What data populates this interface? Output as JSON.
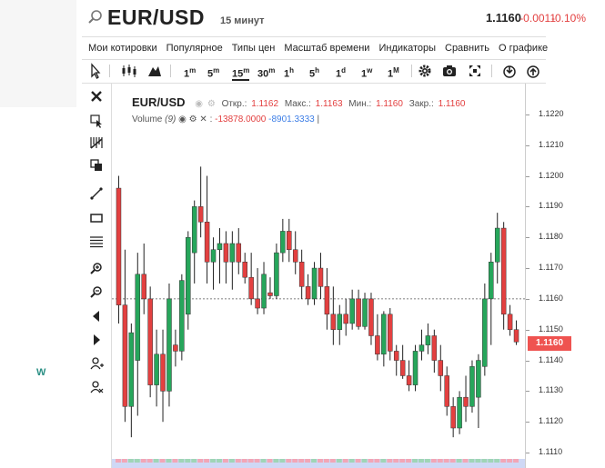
{
  "header": {
    "symbol": "EUR/USD",
    "interval": "15 минут",
    "price": "1.1160",
    "change": "-0.0011",
    "change_pct": "-0.10%"
  },
  "menu": [
    "Мои котировки",
    "Популярное",
    "Типы цен",
    "Масштаб времени",
    "Индикаторы",
    "Сравнить",
    "О графике"
  ],
  "toolbar": {
    "timeframes": [
      {
        "base": "1",
        "sup": "m",
        "active": false
      },
      {
        "base": "5",
        "sup": "m",
        "active": false
      },
      {
        "base": "15",
        "sup": "m",
        "active": true
      },
      {
        "base": "30",
        "sup": "m",
        "active": false
      },
      {
        "base": "1",
        "sup": "h",
        "active": false
      },
      {
        "base": "5",
        "sup": "h",
        "active": false
      },
      {
        "base": "1",
        "sup": "d",
        "active": false
      },
      {
        "base": "1",
        "sup": "w",
        "active": false
      },
      {
        "base": "1",
        "sup": "M",
        "active": false
      }
    ],
    "icons": [
      "cursor-icon",
      "candles-icon",
      "area-chart-icon",
      "settings-icon",
      "camera-icon",
      "fullscreen-icon",
      "download-icon",
      "upload-icon"
    ]
  },
  "side_tools": [
    "close-icon",
    "select-tool-icon",
    "measure-icon",
    "clone-icon",
    "trend-line-icon",
    "rectangle-icon",
    "fib-lines-icon",
    "zoom-in-icon",
    "zoom-out-icon",
    "scroll-left-icon",
    "scroll-right-icon",
    "magnet-add-icon",
    "magnet-remove-icon"
  ],
  "legend": {
    "symbol": "EUR/USD",
    "open_label": "Откр.:",
    "open": "1.1162",
    "high_label": "Макс.:",
    "high": "1.1163",
    "low_label": "Мин.:",
    "low": "1.1160",
    "close_label": "Закр.:",
    "close": "1.1160",
    "volume_label": "Volume",
    "volume_period": "(9)",
    "volume_a": "-13878.0000",
    "volume_b": "-8901.3333"
  },
  "axis": {
    "ticks": [
      "1.1220",
      "1.1210",
      "1.1200",
      "1.1190",
      "1.1180",
      "1.1170",
      "1.1160",
      "1.1150",
      "1.1140",
      "1.1130",
      "1.1120",
      "1.1110"
    ],
    "current": "1.1160"
  },
  "colors": {
    "up": "#26a65b",
    "down": "#e34040",
    "price_tag": "#ef5350"
  },
  "chart_data": {
    "type": "candlestick",
    "ylim": [
      1.1105,
      1.123
    ],
    "candles": [
      {
        "o": 1.1196,
        "h": 1.12,
        "l": 1.1152,
        "c": 1.1158
      },
      {
        "o": 1.1158,
        "h": 1.1176,
        "l": 1.112,
        "c": 1.1125
      },
      {
        "o": 1.1125,
        "h": 1.1152,
        "l": 1.1115,
        "c": 1.1149
      },
      {
        "o": 1.114,
        "h": 1.1175,
        "l": 1.1122,
        "c": 1.1168
      },
      {
        "o": 1.1168,
        "h": 1.1178,
        "l": 1.1155,
        "c": 1.116
      },
      {
        "o": 1.116,
        "h": 1.1164,
        "l": 1.1128,
        "c": 1.1132
      },
      {
        "o": 1.1132,
        "h": 1.115,
        "l": 1.1125,
        "c": 1.1142
      },
      {
        "o": 1.1142,
        "h": 1.115,
        "l": 1.112,
        "c": 1.113
      },
      {
        "o": 1.113,
        "h": 1.1165,
        "l": 1.1125,
        "c": 1.116
      },
      {
        "o": 1.1145,
        "h": 1.115,
        "l": 1.1138,
        "c": 1.1143
      },
      {
        "o": 1.1143,
        "h": 1.1168,
        "l": 1.114,
        "c": 1.1166
      },
      {
        "o": 1.1155,
        "h": 1.1182,
        "l": 1.115,
        "c": 1.118
      },
      {
        "o": 1.1175,
        "h": 1.1192,
        "l": 1.1165,
        "c": 1.119
      },
      {
        "o": 1.119,
        "h": 1.1203,
        "l": 1.118,
        "c": 1.1185
      },
      {
        "o": 1.1185,
        "h": 1.12,
        "l": 1.1165,
        "c": 1.1172
      },
      {
        "o": 1.1172,
        "h": 1.118,
        "l": 1.1163,
        "c": 1.1176
      },
      {
        "o": 1.1176,
        "h": 1.1183,
        "l": 1.1165,
        "c": 1.1178
      },
      {
        "o": 1.1178,
        "h": 1.1182,
        "l": 1.1165,
        "c": 1.1172
      },
      {
        "o": 1.1172,
        "h": 1.1182,
        "l": 1.1163,
        "c": 1.1178
      },
      {
        "o": 1.1178,
        "h": 1.1183,
        "l": 1.1168,
        "c": 1.1172
      },
      {
        "o": 1.1172,
        "h": 1.1175,
        "l": 1.1165,
        "c": 1.1167
      },
      {
        "o": 1.1167,
        "h": 1.1175,
        "l": 1.1158,
        "c": 1.116
      },
      {
        "o": 1.116,
        "h": 1.117,
        "l": 1.1155,
        "c": 1.1157
      },
      {
        "o": 1.1157,
        "h": 1.1172,
        "l": 1.1155,
        "c": 1.1168
      },
      {
        "o": 1.1162,
        "h": 1.1167,
        "l": 1.116,
        "c": 1.1161
      },
      {
        "o": 1.1161,
        "h": 1.1178,
        "l": 1.116,
        "c": 1.1175
      },
      {
        "o": 1.1175,
        "h": 1.1186,
        "l": 1.1172,
        "c": 1.1182
      },
      {
        "o": 1.1182,
        "h": 1.1186,
        "l": 1.1172,
        "c": 1.1176
      },
      {
        "o": 1.1176,
        "h": 1.1182,
        "l": 1.1168,
        "c": 1.1172
      },
      {
        "o": 1.1172,
        "h": 1.1176,
        "l": 1.116,
        "c": 1.1164
      },
      {
        "o": 1.1164,
        "h": 1.1168,
        "l": 1.1158,
        "c": 1.116
      },
      {
        "o": 1.116,
        "h": 1.1172,
        "l": 1.1158,
        "c": 1.117
      },
      {
        "o": 1.117,
        "h": 1.1175,
        "l": 1.116,
        "c": 1.1164
      },
      {
        "o": 1.1164,
        "h": 1.117,
        "l": 1.115,
        "c": 1.1155
      },
      {
        "o": 1.1155,
        "h": 1.1164,
        "l": 1.1145,
        "c": 1.115
      },
      {
        "o": 1.115,
        "h": 1.1158,
        "l": 1.1145,
        "c": 1.1155
      },
      {
        "o": 1.1155,
        "h": 1.116,
        "l": 1.1148,
        "c": 1.1152
      },
      {
        "o": 1.1152,
        "h": 1.1163,
        "l": 1.115,
        "c": 1.116
      },
      {
        "o": 1.116,
        "h": 1.1163,
        "l": 1.115,
        "c": 1.1151
      },
      {
        "o": 1.1151,
        "h": 1.1162,
        "l": 1.115,
        "c": 1.116
      },
      {
        "o": 1.116,
        "h": 1.1162,
        "l": 1.1145,
        "c": 1.1148
      },
      {
        "o": 1.1148,
        "h": 1.1155,
        "l": 1.114,
        "c": 1.1142
      },
      {
        "o": 1.1142,
        "h": 1.1156,
        "l": 1.1138,
        "c": 1.1155
      },
      {
        "o": 1.1155,
        "h": 1.1157,
        "l": 1.114,
        "c": 1.1143
      },
      {
        "o": 1.1143,
        "h": 1.1145,
        "l": 1.1135,
        "c": 1.114
      },
      {
        "o": 1.114,
        "h": 1.1145,
        "l": 1.1134,
        "c": 1.1135
      },
      {
        "o": 1.1135,
        "h": 1.114,
        "l": 1.113,
        "c": 1.1132
      },
      {
        "o": 1.1132,
        "h": 1.1145,
        "l": 1.113,
        "c": 1.1143
      },
      {
        "o": 1.1143,
        "h": 1.115,
        "l": 1.114,
        "c": 1.1145
      },
      {
        "o": 1.1145,
        "h": 1.1152,
        "l": 1.1142,
        "c": 1.1148
      },
      {
        "o": 1.1148,
        "h": 1.115,
        "l": 1.1136,
        "c": 1.114
      },
      {
        "o": 1.114,
        "h": 1.1145,
        "l": 1.113,
        "c": 1.1135
      },
      {
        "o": 1.1135,
        "h": 1.1138,
        "l": 1.1122,
        "c": 1.1125
      },
      {
        "o": 1.1125,
        "h": 1.1128,
        "l": 1.1115,
        "c": 1.1118
      },
      {
        "o": 1.1118,
        "h": 1.113,
        "l": 1.1116,
        "c": 1.1128
      },
      {
        "o": 1.1128,
        "h": 1.1135,
        "l": 1.112,
        "c": 1.1125
      },
      {
        "o": 1.1125,
        "h": 1.114,
        "l": 1.1123,
        "c": 1.1138
      },
      {
        "o": 1.1128,
        "h": 1.1142,
        "l": 1.1118,
        "c": 1.114
      },
      {
        "o": 1.1138,
        "h": 1.1165,
        "l": 1.1135,
        "c": 1.116
      },
      {
        "o": 1.116,
        "h": 1.1175,
        "l": 1.1145,
        "c": 1.1172
      },
      {
        "o": 1.1172,
        "h": 1.1188,
        "l": 1.1165,
        "c": 1.1183
      },
      {
        "o": 1.1183,
        "h": 1.1185,
        "l": 1.115,
        "c": 1.1155
      },
      {
        "o": 1.1155,
        "h": 1.1158,
        "l": 1.1148,
        "c": 1.115
      },
      {
        "o": 1.115,
        "h": 1.1153,
        "l": 1.1145,
        "c": 1.1146
      }
    ]
  }
}
